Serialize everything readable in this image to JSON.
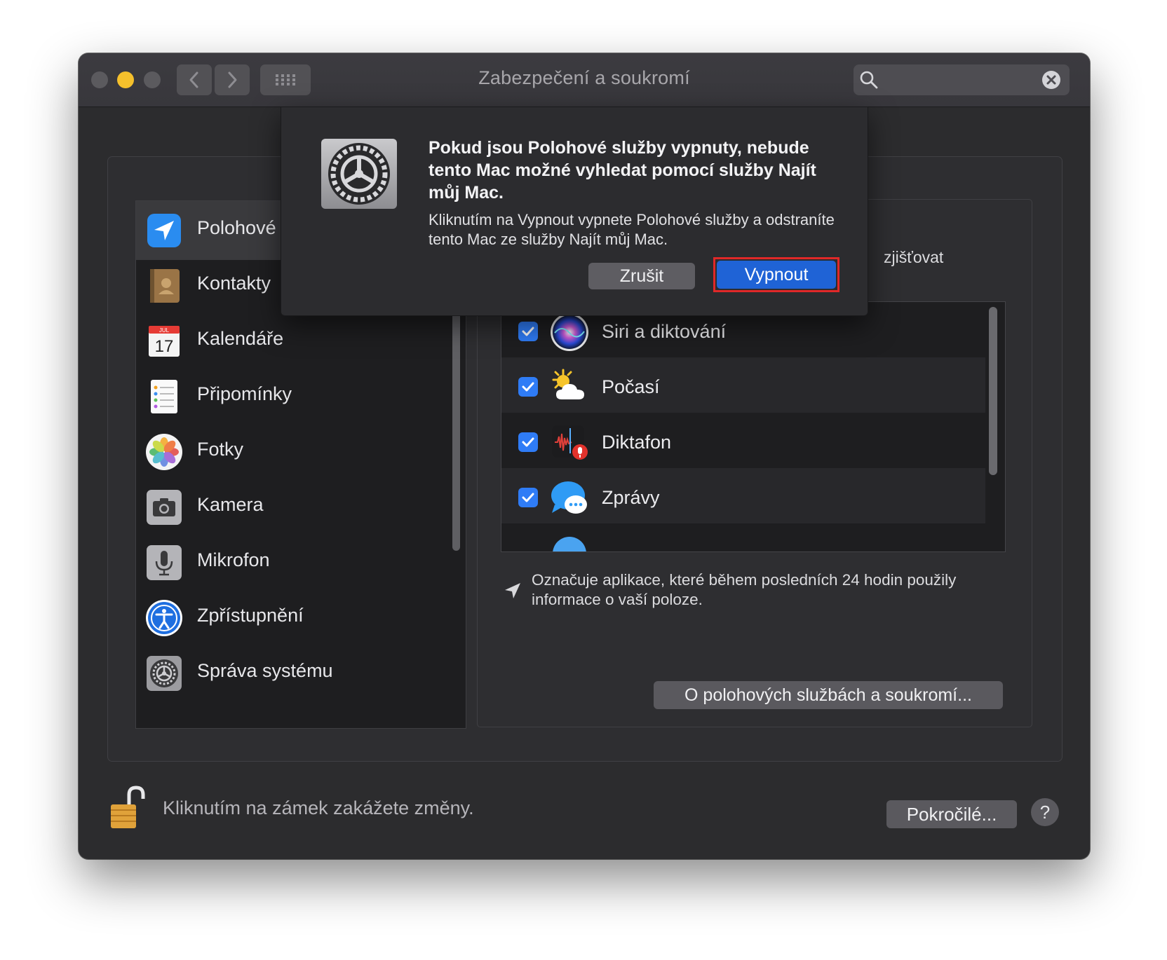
{
  "window": {
    "title": "Zabezpečení a soukromí",
    "search_placeholder": ""
  },
  "sidebar": {
    "items": [
      {
        "label": "Polohové s",
        "icon": "location-arrow-icon",
        "selected": true
      },
      {
        "label": "Kontakty",
        "icon": "contacts-icon"
      },
      {
        "label": "Kalendáře",
        "icon": "calendar-icon"
      },
      {
        "label": "Připomínky",
        "icon": "reminders-icon"
      },
      {
        "label": "Fotky",
        "icon": "photos-icon"
      },
      {
        "label": "Kamera",
        "icon": "camera-icon"
      },
      {
        "label": "Mikrofon",
        "icon": "microphone-icon"
      },
      {
        "label": "Zpřístupnění",
        "icon": "accessibility-icon"
      },
      {
        "label": "Správa systému",
        "icon": "system-prefs-icon"
      }
    ],
    "calendar_month": "JUL",
    "calendar_day": "17"
  },
  "main": {
    "partial_text": "zjišťovat",
    "apps": [
      {
        "label": "Siri a diktování",
        "icon": "siri-icon",
        "checked": true
      },
      {
        "label": "Počasí",
        "icon": "weather-icon",
        "checked": true
      },
      {
        "label": "Diktafon",
        "icon": "voice-memos-icon",
        "checked": true
      },
      {
        "label": "Zprávy",
        "icon": "messages-icon",
        "checked": true
      }
    ],
    "note": "Označuje aplikace, které během posledních 24 hodin použily informace o vaší poloze.",
    "about_button": "O polohových službách a soukromí..."
  },
  "footer": {
    "lock_text": "Kliknutím na zámek zakážete změny.",
    "advanced_button": "Pokročilé...",
    "help_button": "?"
  },
  "dialog": {
    "title": "Pokud jsou Polohové služby vypnuty, nebude tento Mac možné vyhledat pomocí služby Najít můj Mac.",
    "body": "Kliknutím na Vypnout vypnete Polohové služby a odstraníte tento Mac ze služby Najít můj Mac.",
    "cancel_button": "Zrušit",
    "confirm_button": "Vypnout"
  },
  "colors": {
    "window_bg": "#2c2c2e",
    "accent_blue": "#1f63d6",
    "checkbox_blue": "#2f7cf6",
    "highlight_red": "#e02828",
    "traffic_close": "#5b5a5e",
    "traffic_minimize": "#f5c02c",
    "traffic_zoom": "#5b5a5e"
  }
}
